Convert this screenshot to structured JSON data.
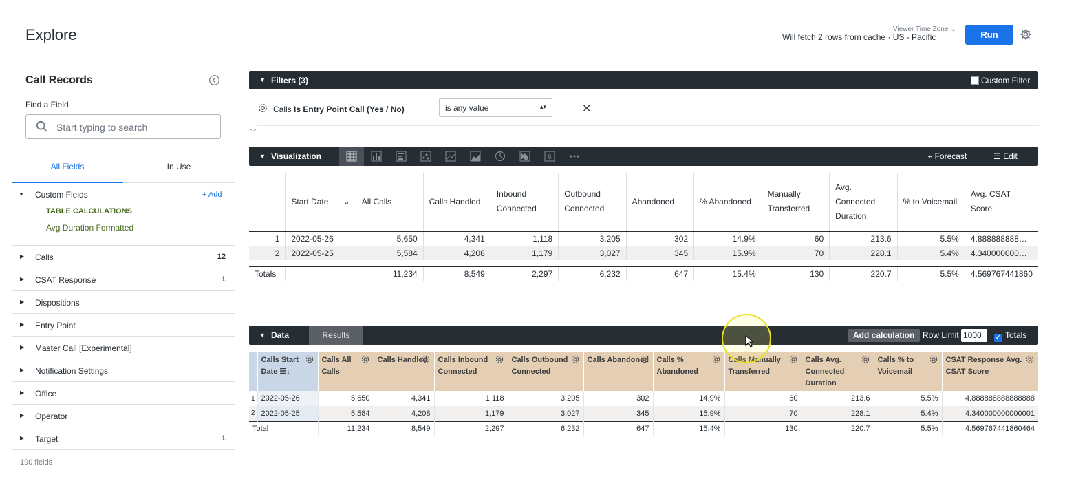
{
  "header": {
    "title": "Explore",
    "timezone_label": "Viewer Time Zone",
    "cache_text": "Will fetch 2 rows from cache · US - Pacific",
    "run_label": "Run"
  },
  "sidebar": {
    "title": "Call Records",
    "find_label": "Find a Field",
    "search_placeholder": "Start typing to search",
    "tab_all": "All Fields",
    "tab_in_use": "In Use",
    "custom_fields": {
      "label": "Custom Fields",
      "add": "+ Add",
      "table_calcs": "TABLE CALCULATIONS",
      "avg_duration": "Avg Duration Formatted"
    },
    "groups": [
      {
        "label": "Calls",
        "count": "12"
      },
      {
        "label": "CSAT Response",
        "count": "1"
      },
      {
        "label": "Dispositions",
        "count": ""
      },
      {
        "label": "Entry Point",
        "count": ""
      },
      {
        "label": "Master Call [Experimental]",
        "count": ""
      },
      {
        "label": "Notification Settings",
        "count": ""
      },
      {
        "label": "Office",
        "count": ""
      },
      {
        "label": "Operator",
        "count": ""
      },
      {
        "label": "Target",
        "count": "1"
      }
    ],
    "field_count": "190 fields"
  },
  "filters": {
    "title": "Filters (3)",
    "custom_filter": "Custom Filter",
    "filter_view": "Calls",
    "filter_field": "Is Entry Point Call (Yes / No)",
    "filter_value": "is any value"
  },
  "viz": {
    "title": "Visualization",
    "forecast": "Forecast",
    "edit": "Edit",
    "headers": [
      "",
      "Start Date",
      "All Calls",
      "Calls Handled",
      "Inbound Connected",
      "Outbound Connected",
      "Abandoned",
      "% Abandoned",
      "Manually Transferred",
      "Avg. Connected Duration",
      "% to Voicemail",
      "Avg. CSAT Score"
    ],
    "rows": [
      [
        "1",
        "2022-05-26",
        "5,650",
        "4,341",
        "1,118",
        "3,205",
        "302",
        "14.9%",
        "60",
        "213.6",
        "5.5%",
        "4.888888888…"
      ],
      [
        "2",
        "2022-05-25",
        "5,584",
        "4,208",
        "1,179",
        "3,027",
        "345",
        "15.9%",
        "70",
        "228.1",
        "5.4%",
        "4.340000000…"
      ]
    ],
    "totals": [
      "Totals",
      "",
      "11,234",
      "8,549",
      "2,297",
      "6,232",
      "647",
      "15.4%",
      "130",
      "220.7",
      "5.5%",
      "4.569767441860"
    ]
  },
  "data": {
    "title": "Data",
    "results_tab": "Results",
    "add_calc": "Add calculation",
    "row_limit_label": "Row Limit",
    "row_limit": "1000",
    "totals_label": "Totals",
    "headers": [
      "Calls Start Date",
      "Calls All Calls",
      "Calls Handled",
      "Calls Inbound Connected",
      "Calls Outbound Connected",
      "Calls Abandoned",
      "Calls % Abandoned",
      "Calls Manually Transferred",
      "Calls Avg. Connected Duration",
      "Calls % to Voicemail",
      "CSAT Response Avg. CSAT Score"
    ],
    "rows": [
      [
        "1",
        "2022-05-26",
        "5,650",
        "4,341",
        "1,118",
        "3,205",
        "302",
        "14.9%",
        "60",
        "213.6",
        "5.5%",
        "4.888888888888888"
      ],
      [
        "2",
        "2022-05-25",
        "5,584",
        "4,208",
        "1,179",
        "3,027",
        "345",
        "15.9%",
        "70",
        "228.1",
        "5.4%",
        "4.340000000000001"
      ]
    ],
    "totals": [
      "Total",
      "11,234",
      "8,549",
      "2,297",
      "6,232",
      "647",
      "15.4%",
      "130",
      "220.7",
      "5.5%",
      "4.569767441860464"
    ]
  },
  "colors": {
    "accent": "#1a73e8",
    "bar": "#262d33",
    "dimension": "#c8d6e6",
    "measure": "#e4cfb5",
    "custom_field": "#4a6a1f"
  }
}
